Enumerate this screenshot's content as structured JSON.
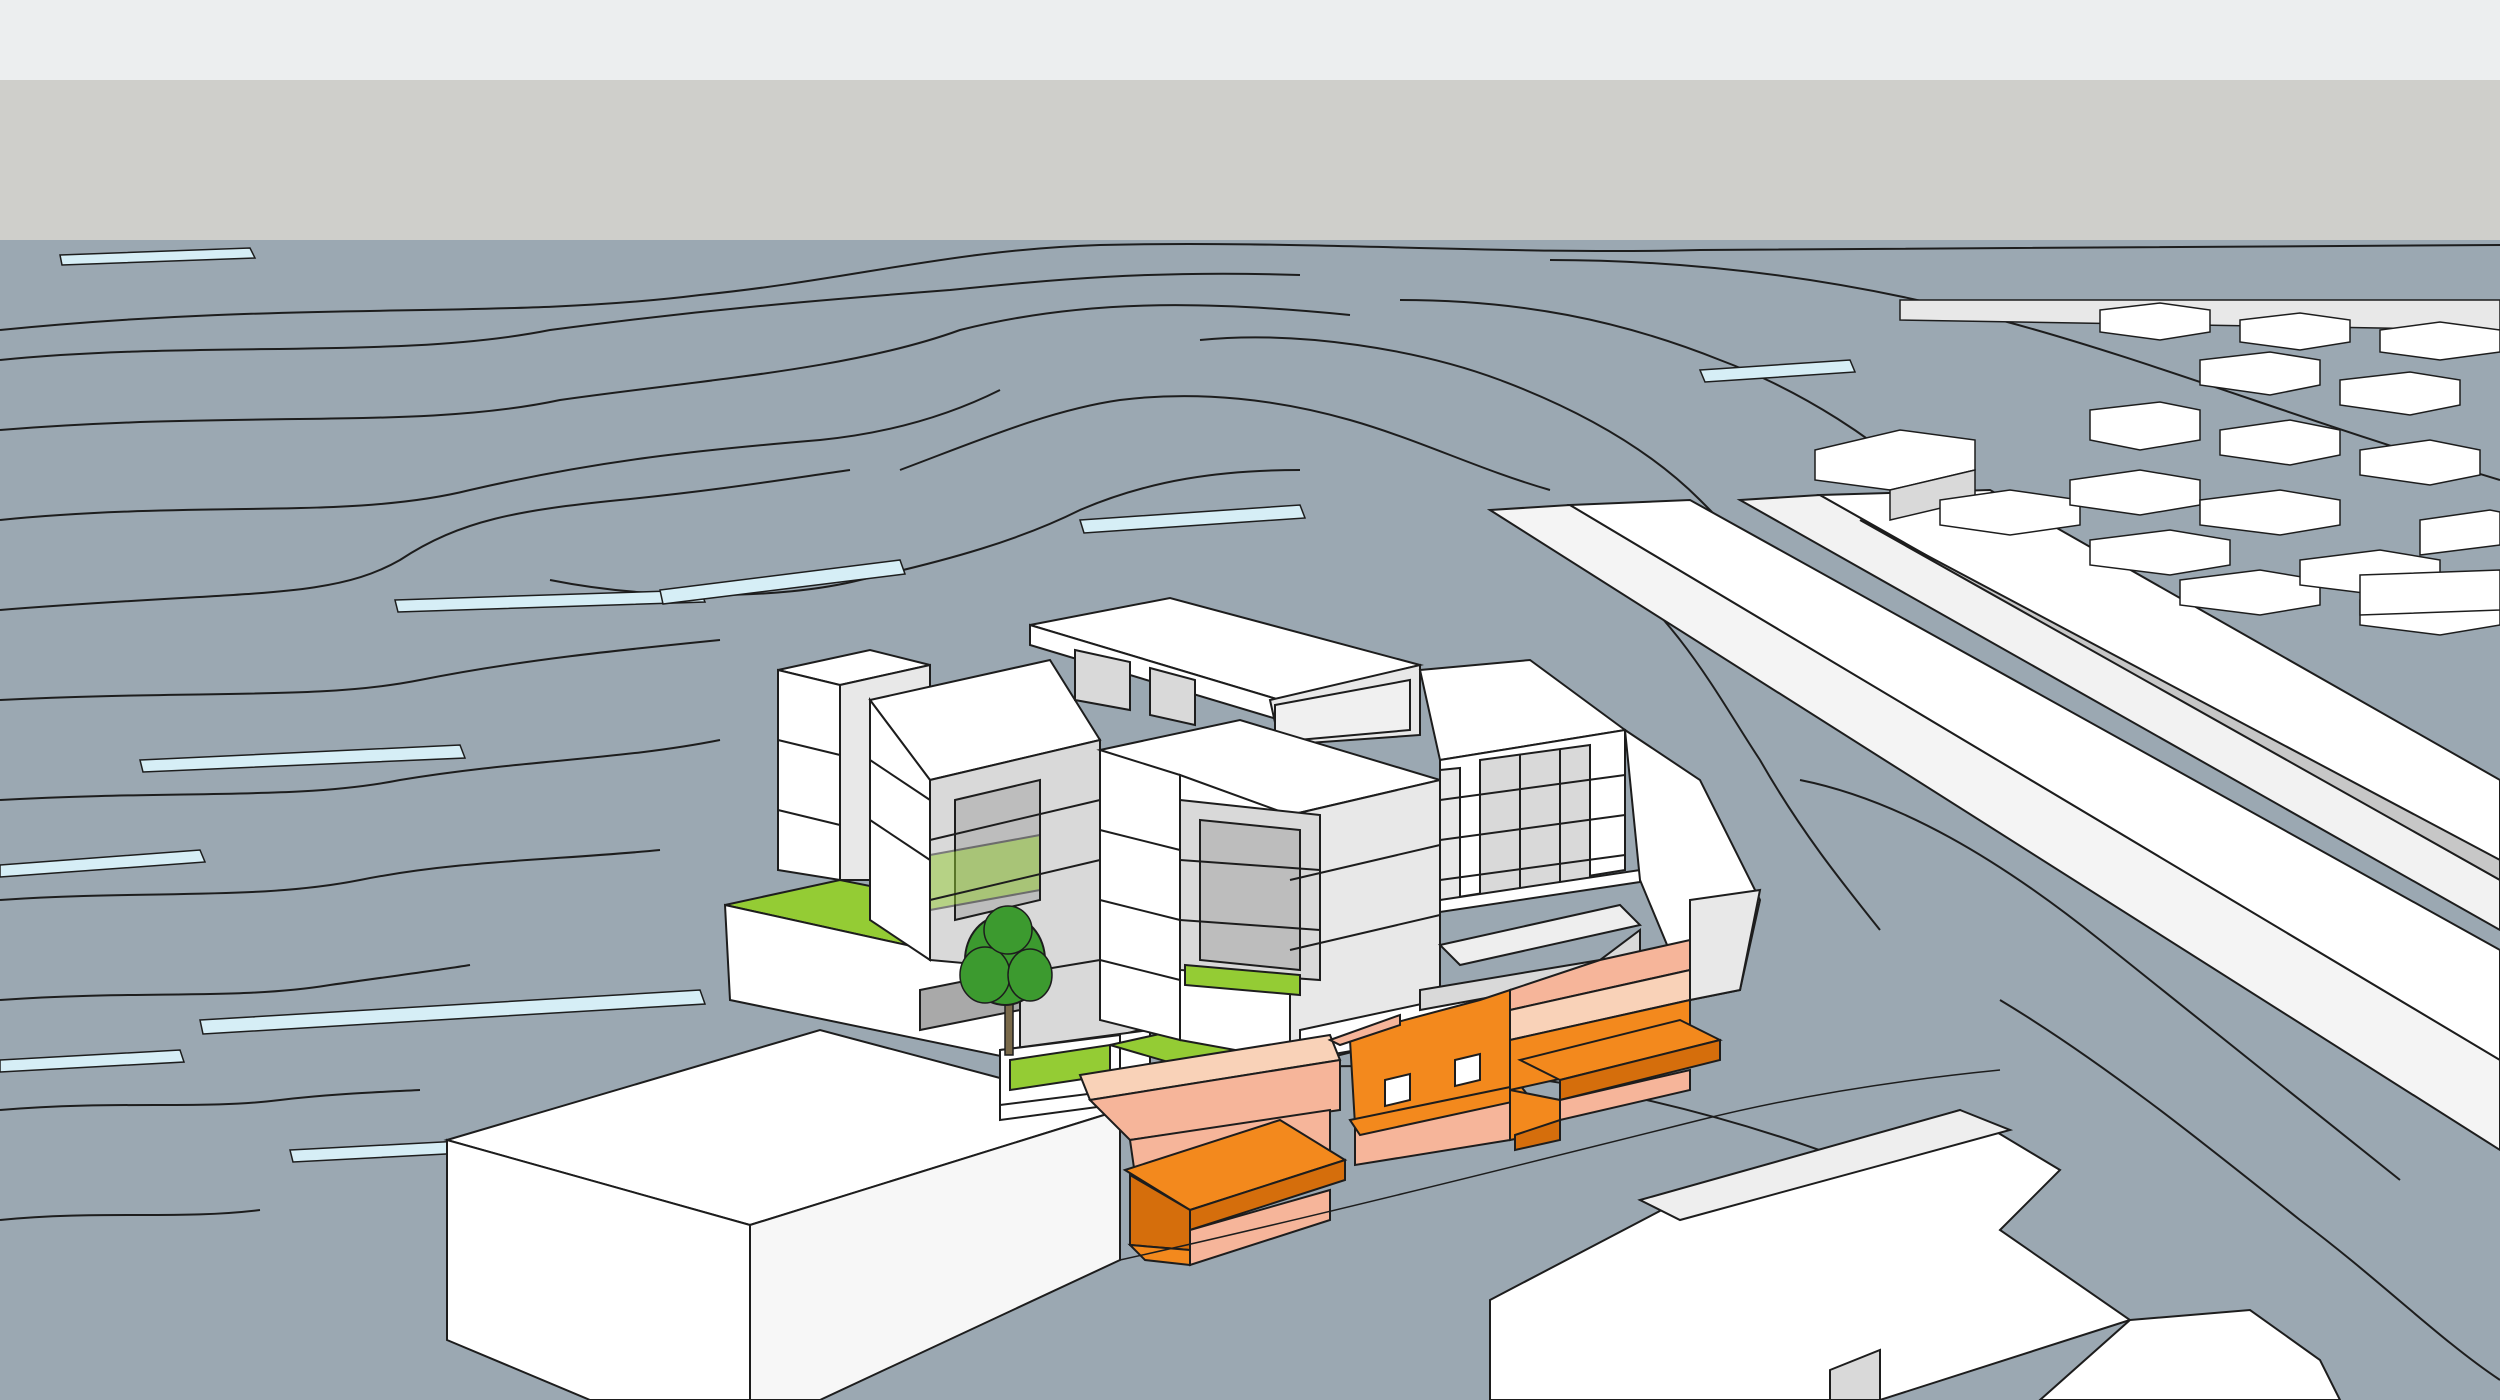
{
  "palette": {
    "top_band": "#eceeef",
    "sky": "#cfcfcb",
    "terrain": "#9ba8b2",
    "terrain_edge": "#d6eef6",
    "line": "#1d1d1d",
    "building_white": "#ffffff",
    "building_shade": "#d9d9d9",
    "building_dark": "#bdbdbd",
    "roof_green": "#94cc34",
    "facade_orange": "#f3891d",
    "facade_orange_dark": "#d56e0c",
    "facade_peach": "#f6b59a",
    "facade_peach_light": "#f9d2b8",
    "tree_green": "#3c9a2f",
    "tree_trunk": "#7a6a4a",
    "window_gray": "#a9a9a9"
  },
  "scene": {
    "description_icons": [
      "tree-icon"
    ]
  }
}
